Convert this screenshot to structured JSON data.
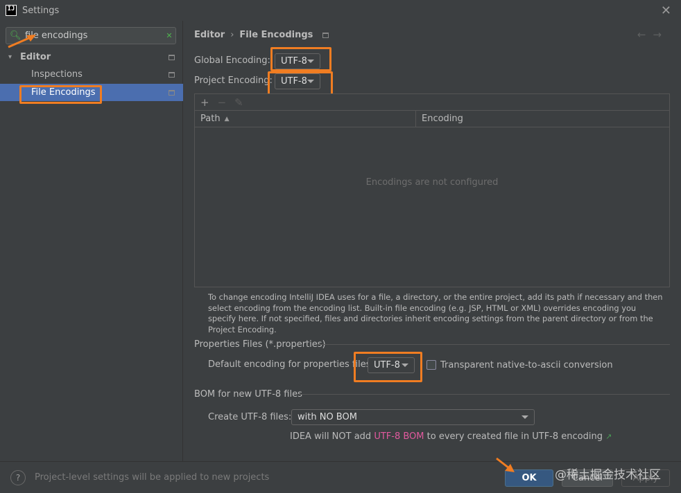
{
  "window": {
    "title": "Settings",
    "app_icon_text": "IJ",
    "close_glyph": "✕"
  },
  "sidebar": {
    "search": {
      "value": "file encodings",
      "placeholder": ""
    },
    "items": [
      {
        "label": "Editor",
        "expanded": true
      },
      {
        "label": "Inspections"
      },
      {
        "label": "File Encodings",
        "selected": true
      }
    ]
  },
  "header": {
    "breadcrumb": [
      "Editor",
      "File Encodings"
    ],
    "separator": "›",
    "nav_back": "←",
    "nav_forward": "→"
  },
  "encodings": {
    "global_label": "Global Encoding:",
    "global_value": "UTF-8",
    "project_label": "Project Encoding:",
    "project_value": "UTF-8"
  },
  "table": {
    "toolbar": {
      "add": "+",
      "remove": "−",
      "edit": "✎"
    },
    "columns": [
      "Path",
      "Encoding"
    ],
    "empty_text": "Encodings are not configured"
  },
  "help_text": "To change encoding IntelliJ IDEA uses for a file, a directory, or the entire project, add its path if necessary and then select encoding from the encoding list. Built-in file encoding (e.g. JSP, HTML or XML) overrides encoding you specify here. If not specified, files and directories inherit encoding settings from the parent directory or from the Project Encoding.",
  "properties": {
    "section_title": "Properties Files (*.properties)",
    "default_label": "Default encoding for properties files:",
    "default_value": "UTF-8",
    "native_to_ascii_label": "Transparent native-to-ascii conversion",
    "native_to_ascii_checked": false
  },
  "bom": {
    "section_title": "BOM for new UTF-8 files",
    "create_label": "Create UTF-8 files:",
    "create_value": "with NO BOM",
    "note_prefix": "IDEA will NOT add",
    "note_accent": "UTF-8 BOM",
    "note_suffix": "to every created file in UTF-8 encoding",
    "note_link_glyph": "↗"
  },
  "footer": {
    "help_glyph": "?",
    "status": "Project-level settings will be applied to new projects",
    "ok": "OK",
    "cancel": "Cancel",
    "apply": "Apply",
    "watermark": "@稀土掘金技术社区"
  },
  "colors": {
    "background": "#3c3f41",
    "selection": "#4b6eaf",
    "highlight": "#f07d22",
    "ok_button": "#365880",
    "accent_text": "#e25a9f"
  }
}
